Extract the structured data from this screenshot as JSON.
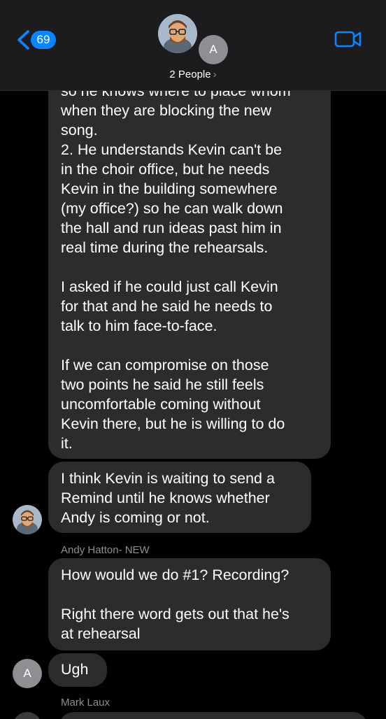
{
  "header": {
    "back_count": "69",
    "avatar_letter": "A",
    "people_label": "2 People",
    "people_chevron": "›"
  },
  "messages": [
    {
      "id": "msg1",
      "text": "so he knows where to place whom\nwhen they are blocking the new\nsong.\n2. He understands Kevin can't be\nin the choir office, but he needs\nKevin in the building somewhere\n(my office?) so he can walk down\nthe hall and run ideas past him in\nreal time during the rehearsals.\n\nI asked if he could just call Kevin\nfor that and he said he needs to\ntalk to him face-to-face.\n\nIf we can compromise on those\ntwo points he said he still feels\nuncomfortable coming without\nKevin there, but he is willing to do\nit."
    },
    {
      "id": "msg2",
      "text": "I think Kevin is waiting to send a\nRemind until he knows whether\nAndy is coming or not."
    },
    {
      "id": "msg3",
      "sender": "Andy Hatton- NEW",
      "text": "How would we do #1? Recording?\n\nRight there word gets out that he's\nat rehearsal"
    },
    {
      "id": "msg4",
      "text": "Ugh",
      "avatar_letter": "A"
    },
    {
      "id": "msg5",
      "sender": "Mark Laux"
    }
  ],
  "icons": {
    "back": "chevron-left-icon",
    "video": "video-camera-icon",
    "accent": "#0a84ff"
  }
}
